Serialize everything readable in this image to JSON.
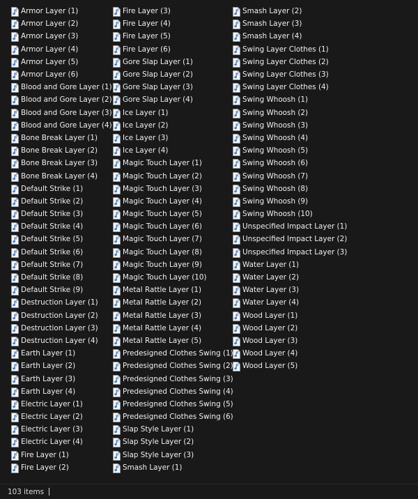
{
  "icon": "audio-file-icon",
  "colors": {
    "background": "#191919",
    "text": "#f0f0f0",
    "icon_note": "#2f7fd8"
  },
  "columns": [
    [
      "Armor Layer (1)",
      "Armor Layer (2)",
      "Armor Layer (3)",
      "Armor Layer (4)",
      "Armor Layer (5)",
      "Armor Layer (6)",
      "Blood and Gore Layer (1)",
      "Blood and Gore Layer (2)",
      "Blood and Gore Layer (3)",
      "Blood and Gore Layer (4)",
      "Bone Break Layer (1)",
      "Bone Break Layer (2)",
      "Bone Break Layer (3)",
      "Bone Break Layer (4)",
      "Default Strike (1)",
      "Default Strike (2)",
      "Default Strike (3)",
      "Default Strike (4)",
      "Default Strike (5)",
      "Default Strike (6)",
      "Default Strike (7)",
      "Default Strike (8)",
      "Default Strike (9)",
      "Destruction Layer (1)",
      "Destruction Layer (2)",
      "Destruction Layer (3)",
      "Destruction Layer (4)",
      "Earth Layer (1)",
      "Earth Layer (2)",
      "Earth Layer (3)",
      "Earth Layer (4)",
      "Electric Layer (1)",
      "Electric Layer (2)",
      "Electric Layer (3)",
      "Electric Layer (4)",
      "Fire Layer (1)",
      "Fire Layer (2)"
    ],
    [
      "Fire Layer (3)",
      "Fire Layer (4)",
      "Fire Layer (5)",
      "Fire Layer (6)",
      "Gore Slap Layer (1)",
      "Gore Slap Layer (2)",
      "Gore Slap Layer (3)",
      "Gore Slap Layer (4)",
      "Ice Layer (1)",
      "Ice Layer (2)",
      "Ice Layer (3)",
      "Ice Layer (4)",
      "Magic Touch Layer (1)",
      "Magic Touch Layer (2)",
      "Magic Touch Layer (3)",
      "Magic Touch Layer (4)",
      "Magic Touch Layer (5)",
      "Magic Touch Layer (6)",
      "Magic Touch Layer (7)",
      "Magic Touch Layer (8)",
      "Magic Touch Layer (9)",
      "Magic Touch Layer (10)",
      "Metal Rattle Layer (1)",
      "Metal Rattle Layer (2)",
      "Metal Rattle Layer (3)",
      "Metal Rattle Layer (4)",
      "Metal Rattle Layer (5)",
      "Predesigned Clothes Swing (1)",
      "Predesigned Clothes Swing (2)",
      "Predesigned Clothes Swing (3)",
      "Predesigned Clothes Swing (4)",
      "Predesigned Clothes Swing (5)",
      "Predesigned Clothes Swing (6)",
      "Slap Style Layer (1)",
      "Slap Style Layer (2)",
      "Slap Style Layer (3)",
      "Smash Layer (1)"
    ],
    [
      "Smash Layer (2)",
      "Smash Layer (3)",
      "Smash Layer (4)",
      "Swing Layer Clothes (1)",
      "Swing Layer Clothes (2)",
      "Swing Layer Clothes (3)",
      "Swing Layer Clothes (4)",
      "Swing Whoosh (1)",
      "Swing Whoosh (2)",
      "Swing Whoosh (3)",
      "Swing Whoosh (4)",
      "Swing Whoosh (5)",
      "Swing Whoosh (6)",
      "Swing Whoosh (7)",
      "Swing Whoosh (8)",
      "Swing Whoosh (9)",
      "Swing Whoosh (10)",
      "Unspecified Impact Layer (1)",
      "Unspecified Impact Layer (2)",
      "Unspecified Impact Layer (3)",
      "Water Layer (1)",
      "Water Layer (2)",
      "Water Layer (3)",
      "Water Layer (4)",
      "Wood Layer (1)",
      "Wood Layer (2)",
      "Wood Layer (3)",
      "Wood Layer (4)",
      "Wood Layer (5)"
    ]
  ],
  "status": {
    "item_count": "103 items"
  }
}
